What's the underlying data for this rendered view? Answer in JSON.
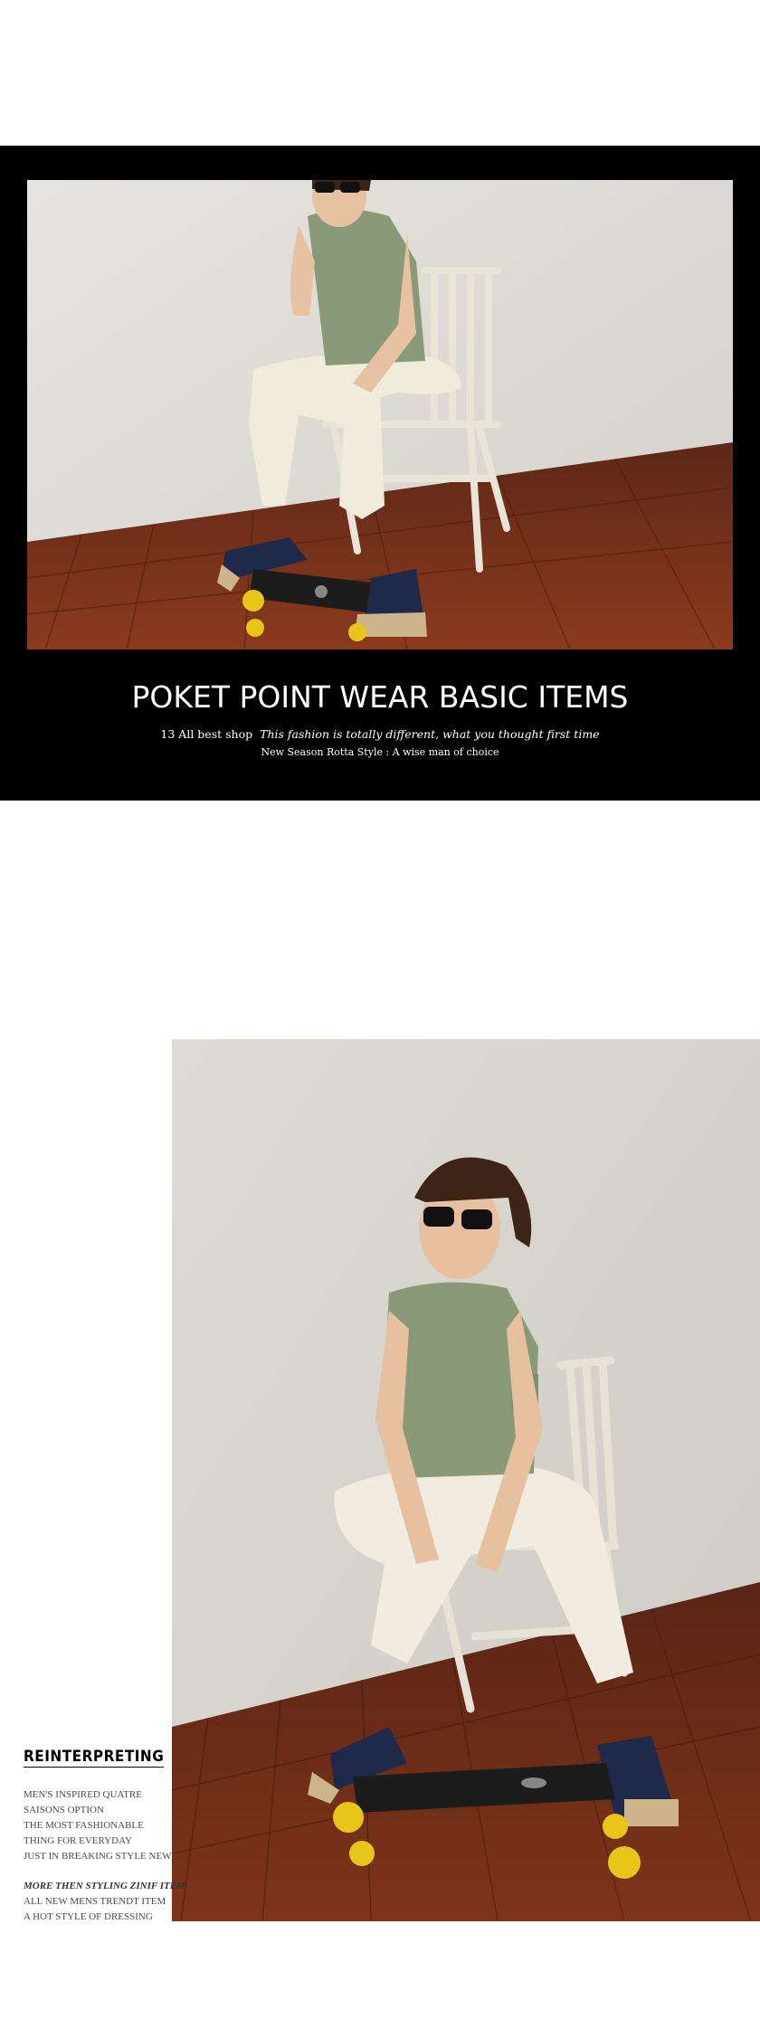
{
  "hero": {
    "title": "POKET POINT WEAR BASIC ITEMS",
    "shop_label": "13 All best shop",
    "tagline_italic": "This fashion is totally different, what you thought first time",
    "subtitle": "New Season Rotta Style : A wise man of choice",
    "photo_alt": "Man in sunglasses, sage t-shirt and white chinos sitting on a white wooden chair with a skateboard"
  },
  "feature": {
    "photo_alt": "Man in sunglasses sitting on white chair, feet on a black skateboard with yellow wheels",
    "heading": "REINTERPRETING",
    "lines": [
      "MEN'S INSPIRED QUATRE",
      "SAISONS OPTION",
      "THE MOST FASHIONABLE",
      "THING FOR EVERYDAY",
      "JUST IN BREAKING STYLE NEWS"
    ],
    "lines2_emph": "MORE THEN STYLING ZINIF ITEM",
    "lines2": [
      "ALL NEW MENS TRENDT ITEM",
      "A HOT STYLE OF DRESSING"
    ]
  },
  "colors": {
    "banner": "#000000",
    "wood_floor": "#6a2a16",
    "wall": "#dcd9d3",
    "tshirt": "#8a9a78",
    "wheels": "#e8c619"
  }
}
